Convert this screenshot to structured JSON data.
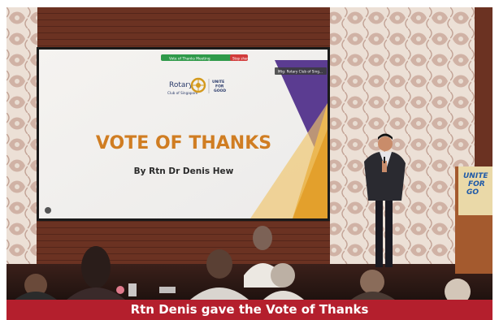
{
  "caption": "Rtn Denis gave the Vote of Thanks",
  "slide": {
    "top_bar_text": "Vote of Thanks Meeting",
    "stop_share_label": "Stop share",
    "meeting_label": "Mtg: Rotary Club of Sing...",
    "brand_name": "Rotary",
    "brand_sub": "Club of Singapore",
    "slogan_lines": [
      "UNITE",
      "FOR",
      "GOOD"
    ],
    "title": "VOTE OF THANKS",
    "subtitle": "By Rtn Dr Denis Hew"
  },
  "podium_text_lines": [
    "UNITE",
    "FOR",
    "GO"
  ],
  "colors": {
    "caption_bg": "#b41f2d",
    "slide_title": "#d07d22",
    "slide_purple": "#5b3c91",
    "slide_gold": "#e3a02c",
    "wall_wood": "#6b3222",
    "lace_panel": "#efe4da"
  }
}
